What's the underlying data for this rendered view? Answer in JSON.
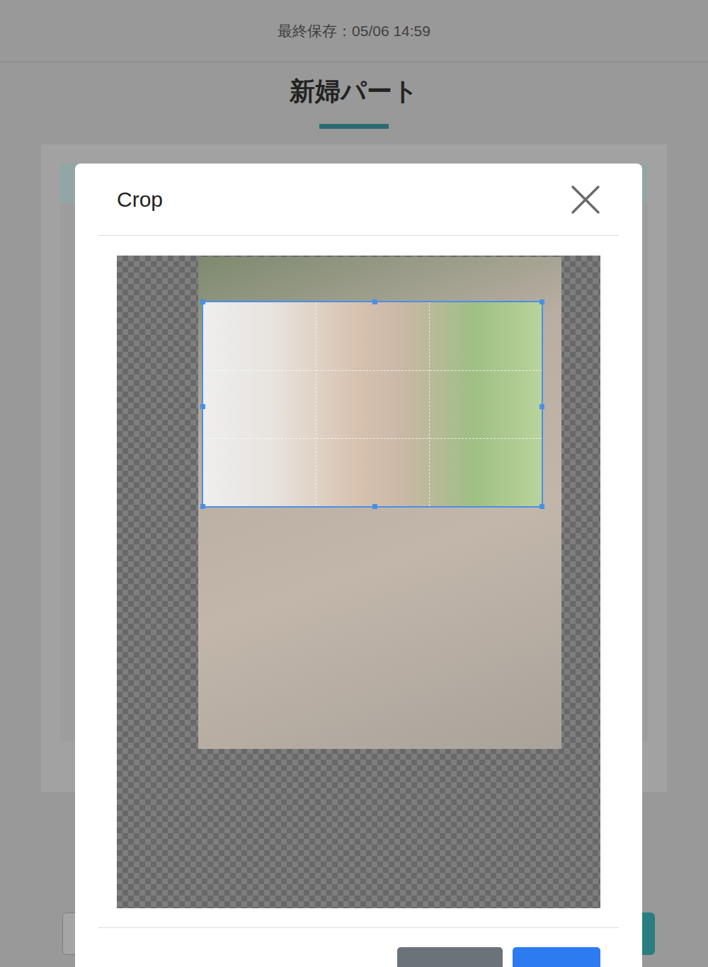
{
  "header": {
    "last_saved": "最終保存：05/06 14:59"
  },
  "page": {
    "title": "新婦パート"
  },
  "modal": {
    "title": "Crop",
    "footer_buttons": [
      {
        "kind": "secondary"
      },
      {
        "kind": "primary"
      }
    ]
  }
}
